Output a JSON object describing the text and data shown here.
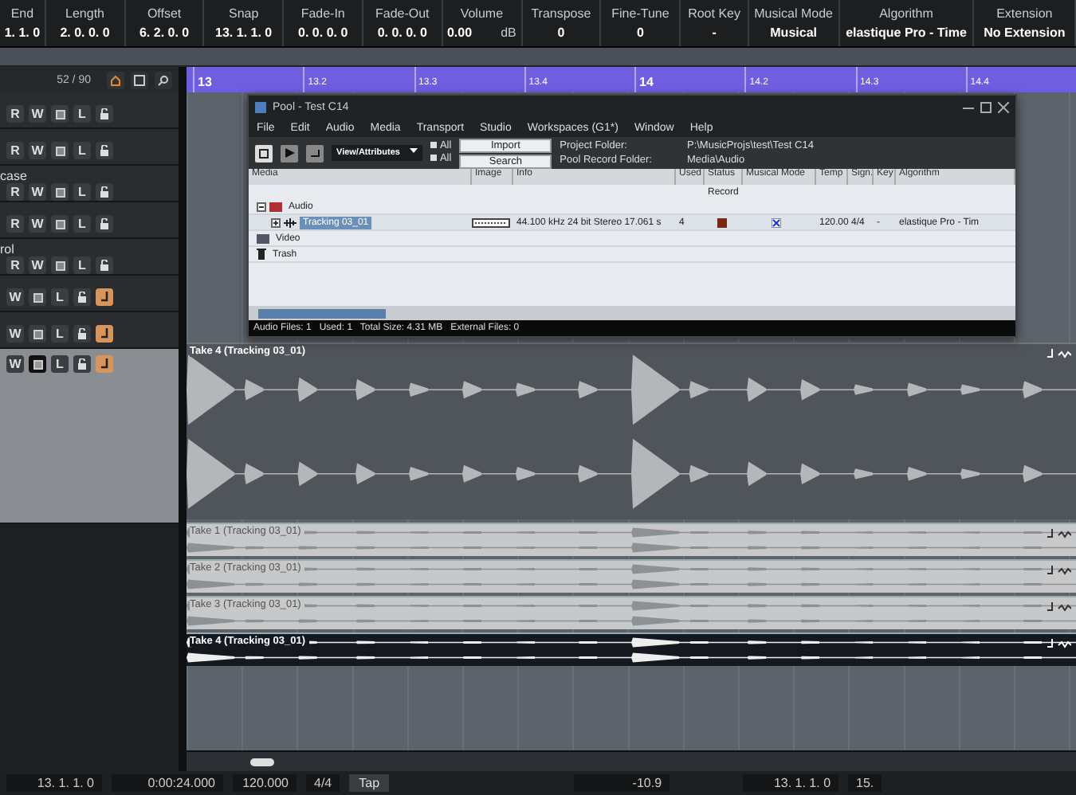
{
  "info_line": [
    {
      "label": "End",
      "value": "1. 1. 0"
    },
    {
      "label": "Length",
      "value": "2. 0. 0. 0"
    },
    {
      "label": "Offset",
      "value": "6. 2. 0. 0"
    },
    {
      "label": "Snap",
      "value": "13. 1. 1. 0"
    },
    {
      "label": "Fade-In",
      "value": "0. 0. 0. 0"
    },
    {
      "label": "Fade-Out",
      "value": "0. 0. 0. 0"
    },
    {
      "label": "Volume",
      "value": "0.00",
      "unit": "dB"
    },
    {
      "label": "Transpose",
      "value": "0"
    },
    {
      "label": "Fine-Tune",
      "value": "0"
    },
    {
      "label": "Root Key",
      "value": "-"
    },
    {
      "label": "Musical Mode",
      "value": "Musical"
    },
    {
      "label": "Algorithm",
      "value": "elastique Pro - Time"
    },
    {
      "label": "Extension",
      "value": "No Extension"
    }
  ],
  "track_list": {
    "counter": "52 / 90",
    "tracks": [
      {
        "selected": false,
        "buttons": [
          {
            "kind": "text",
            "label": "R"
          },
          {
            "kind": "text",
            "label": "W"
          },
          {
            "kind": "monitor",
            "on": false
          },
          {
            "kind": "text",
            "label": "L"
          },
          {
            "kind": "lock"
          }
        ]
      },
      {
        "selected": false,
        "buttons": [
          {
            "kind": "text",
            "label": "R"
          },
          {
            "kind": "text",
            "label": "W"
          },
          {
            "kind": "monitor",
            "on": false
          },
          {
            "kind": "text",
            "label": "L"
          },
          {
            "kind": "lock"
          }
        ]
      },
      {
        "name": "case",
        "selected": false,
        "buttons": [
          {
            "kind": "text",
            "label": "R"
          },
          {
            "kind": "text",
            "label": "W"
          },
          {
            "kind": "monitor",
            "on": false
          },
          {
            "kind": "text",
            "label": "L"
          },
          {
            "kind": "lock"
          }
        ]
      },
      {
        "selected": false,
        "buttons": [
          {
            "kind": "text",
            "label": "R"
          },
          {
            "kind": "text",
            "label": "W"
          },
          {
            "kind": "monitor",
            "on": false
          },
          {
            "kind": "text",
            "label": "L"
          },
          {
            "kind": "lock"
          }
        ]
      },
      {
        "name": "rol",
        "selected": false,
        "buttons": [
          {
            "kind": "text",
            "label": "R"
          },
          {
            "kind": "text",
            "label": "W"
          },
          {
            "kind": "monitor",
            "on": false
          },
          {
            "kind": "text",
            "label": "L"
          },
          {
            "kind": "lock"
          }
        ]
      },
      {
        "selected": false,
        "buttons": [
          {
            "kind": "text",
            "label": "W"
          },
          {
            "kind": "monitor",
            "on": false
          },
          {
            "kind": "text",
            "label": "L"
          },
          {
            "kind": "lock"
          },
          {
            "kind": "timebase",
            "on": true
          }
        ]
      },
      {
        "selected": false,
        "buttons": [
          {
            "kind": "text",
            "label": "W"
          },
          {
            "kind": "monitor",
            "on": false
          },
          {
            "kind": "text",
            "label": "L"
          },
          {
            "kind": "lock"
          },
          {
            "kind": "timebase",
            "on": true
          }
        ]
      },
      {
        "selected": true,
        "buttons": [
          {
            "kind": "text",
            "label": "W"
          },
          {
            "kind": "monitor",
            "on": true
          },
          {
            "kind": "text",
            "label": "L"
          },
          {
            "kind": "lock"
          },
          {
            "kind": "timebase",
            "on": true
          }
        ]
      }
    ]
  },
  "ruler": [
    {
      "label": "13",
      "bar": true
    },
    {
      "label": "13.2",
      "bar": false
    },
    {
      "label": "13.3",
      "bar": false
    },
    {
      "label": "13.4",
      "bar": false
    },
    {
      "label": "14",
      "bar": true
    },
    {
      "label": "14.2",
      "bar": false
    },
    {
      "label": "14.3",
      "bar": false
    },
    {
      "label": "14.4",
      "bar": false
    }
  ],
  "pool": {
    "title": "Pool - Test C14",
    "menu": [
      "File",
      "Edit",
      "Audio",
      "Media",
      "Transport",
      "Studio",
      "Workspaces (G1*)",
      "Window",
      "Help"
    ],
    "view": "View/Attributes",
    "all_1": "All",
    "all_2": "All",
    "import": "Import",
    "search": "Search",
    "folders": [
      {
        "label": "Project Folder:",
        "value": "P:\\MusicProjs\\test\\Test C14"
      },
      {
        "label": "Pool Record Folder:",
        "value": "Media\\Audio"
      }
    ],
    "columns": [
      "Media",
      "Image",
      "Info",
      "Used",
      "Status",
      "Musical Mode",
      "Temp",
      "Sign.",
      "Key",
      "Algorithm"
    ],
    "record_label": "Record",
    "tree": [
      {
        "name": "Audio",
        "kind": "audio",
        "expanded": true,
        "children": [
          {
            "name": "Tracking 03_01",
            "kind": "clip",
            "selected": true,
            "expanded": false,
            "info": "44.100 kHz  24 bit  Stereo  17.061 s",
            "used": "4",
            "record": true,
            "musical": true,
            "tempo": "120.00",
            "sign": "4/4",
            "key": "-",
            "algorithm": "elastique Pro - Tim"
          }
        ]
      },
      {
        "name": "Video",
        "kind": "video"
      },
      {
        "name": "Trash",
        "kind": "trash"
      }
    ],
    "status": "Audio Files: 1   Used: 1   Total Size: 4.31 MB   External Files: 0"
  },
  "takes": [
    {
      "name": "Take 4 (Tracking 03_01)",
      "kind": "main"
    },
    {
      "name": "Take 1 (Tracking 03_01)",
      "kind": "lane",
      "selected": false
    },
    {
      "name": "Take 2 (Tracking 03_01)",
      "kind": "lane",
      "selected": false
    },
    {
      "name": "Take 3 (Tracking 03_01)",
      "kind": "lane",
      "selected": false
    },
    {
      "name": "Take 4 (Tracking 03_01)",
      "kind": "lane",
      "selected": true
    }
  ],
  "transport": {
    "position": "13. 1. 1. 0",
    "time": "0:00:24.000",
    "tempo": "120.000",
    "signature": "4/4",
    "tap": "Tap",
    "level": "-10.9",
    "locator": "13. 1. 1. 0",
    "locator_2": "15."
  }
}
